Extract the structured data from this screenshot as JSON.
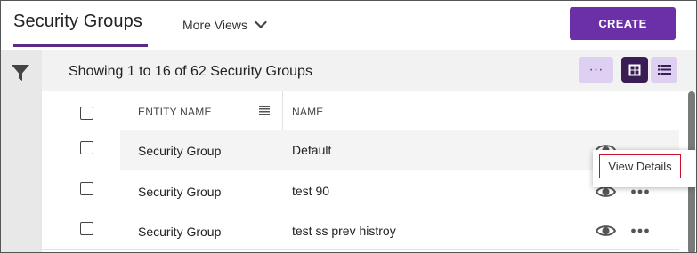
{
  "header": {
    "title": "Security Groups",
    "more_views_label": "More Views",
    "create_label": "CREATE"
  },
  "toolbar": {
    "showing_text": "Showing 1 to 16 of 62 Security Groups",
    "more_label": "···"
  },
  "table": {
    "columns": [
      "ENTITY NAME",
      "NAME"
    ],
    "rows": [
      {
        "entity": "Security Group",
        "name": "Default"
      },
      {
        "entity": "Security Group",
        "name": "test 90"
      },
      {
        "entity": "Security Group",
        "name": "test ss prev histroy"
      }
    ]
  },
  "tooltip": {
    "label": "View Details"
  },
  "colors": {
    "accent": "#6b2fa8",
    "accent_dark": "#3a1d55",
    "accent_light": "#ddd0f0",
    "highlight_border": "#c8102e"
  },
  "icons": [
    "filter-icon",
    "chevron-down-icon",
    "grid-view-icon",
    "list-view-icon",
    "column-menu-icon",
    "eye-icon",
    "more-options-icon"
  ]
}
